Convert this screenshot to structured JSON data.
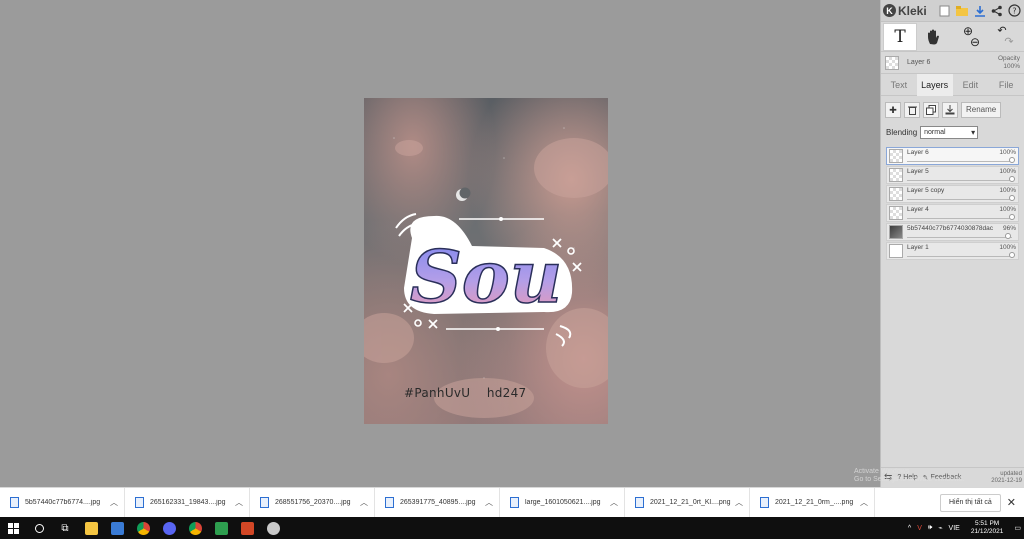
{
  "canvas": {
    "watermark": "#PanhUvU    hd247",
    "logo_text": "Sou"
  },
  "app": {
    "name": "Kleki"
  },
  "toolbar": {
    "icons": [
      "new-file-icon",
      "open-folder-icon",
      "download-icon",
      "share-icon",
      "help-icon"
    ]
  },
  "tools": {
    "text_tool": "T",
    "hand_tool": "hand",
    "zoom_in": "⊕",
    "zoom_out": "⊖",
    "undo": "↶",
    "redo": "↷"
  },
  "current_layer": {
    "name": "Layer 6",
    "opacity_label": "Opacity",
    "opacity_value": "100%"
  },
  "tabs": [
    {
      "label": "Text",
      "active": false
    },
    {
      "label": "Layers",
      "active": true
    },
    {
      "label": "Edit",
      "active": false
    },
    {
      "label": "File",
      "active": false
    }
  ],
  "layer_actions": {
    "rename": "Rename"
  },
  "blending": {
    "label": "Blending",
    "value": "normal"
  },
  "layers": [
    {
      "name": "Layer 6",
      "opacity": "100%",
      "level": 1.0,
      "active": true
    },
    {
      "name": "Layer 5",
      "opacity": "100%",
      "level": 1.0,
      "active": false
    },
    {
      "name": "Layer 5 copy",
      "opacity": "100%",
      "level": 1.0,
      "active": false
    },
    {
      "name": "Layer 4",
      "opacity": "100%",
      "level": 1.0,
      "active": false
    },
    {
      "name": "5b57440c77b6774030878dac",
      "opacity": "96%",
      "level": 0.96,
      "active": false
    },
    {
      "name": "Layer 1",
      "opacity": "100%",
      "level": 1.0,
      "active": false
    }
  ],
  "footer": {
    "help": "Help",
    "feedback": "Feedback",
    "updated_label": "updated",
    "updated_date": "2021-12-19"
  },
  "activate_windows": {
    "line1": "Activate Windows",
    "line2": "Go to Settings to activate Windows."
  },
  "downloads": [
    {
      "name": "5b57440c77b6774....jpg"
    },
    {
      "name": "265162331_19843....jpg"
    },
    {
      "name": "268551756_20370....jpg"
    },
    {
      "name": "265391775_40895....jpg"
    },
    {
      "name": "large_1601050621....jpg"
    },
    {
      "name": "2021_12_21_0rt_Kl....png"
    },
    {
      "name": "2021_12_21_0rm_....png"
    }
  ],
  "show_all": "Hiển thị tất cả",
  "taskbar": {
    "lang": "VIE",
    "time": "5:51 PM",
    "date": "21/12/2021"
  },
  "colors": {
    "panel_bg": "#d9d9d9",
    "canvas_bg": "#9b9b9b",
    "taskbar_bg": "#0f0f0f",
    "accent_blue": "#2d6fd2"
  }
}
